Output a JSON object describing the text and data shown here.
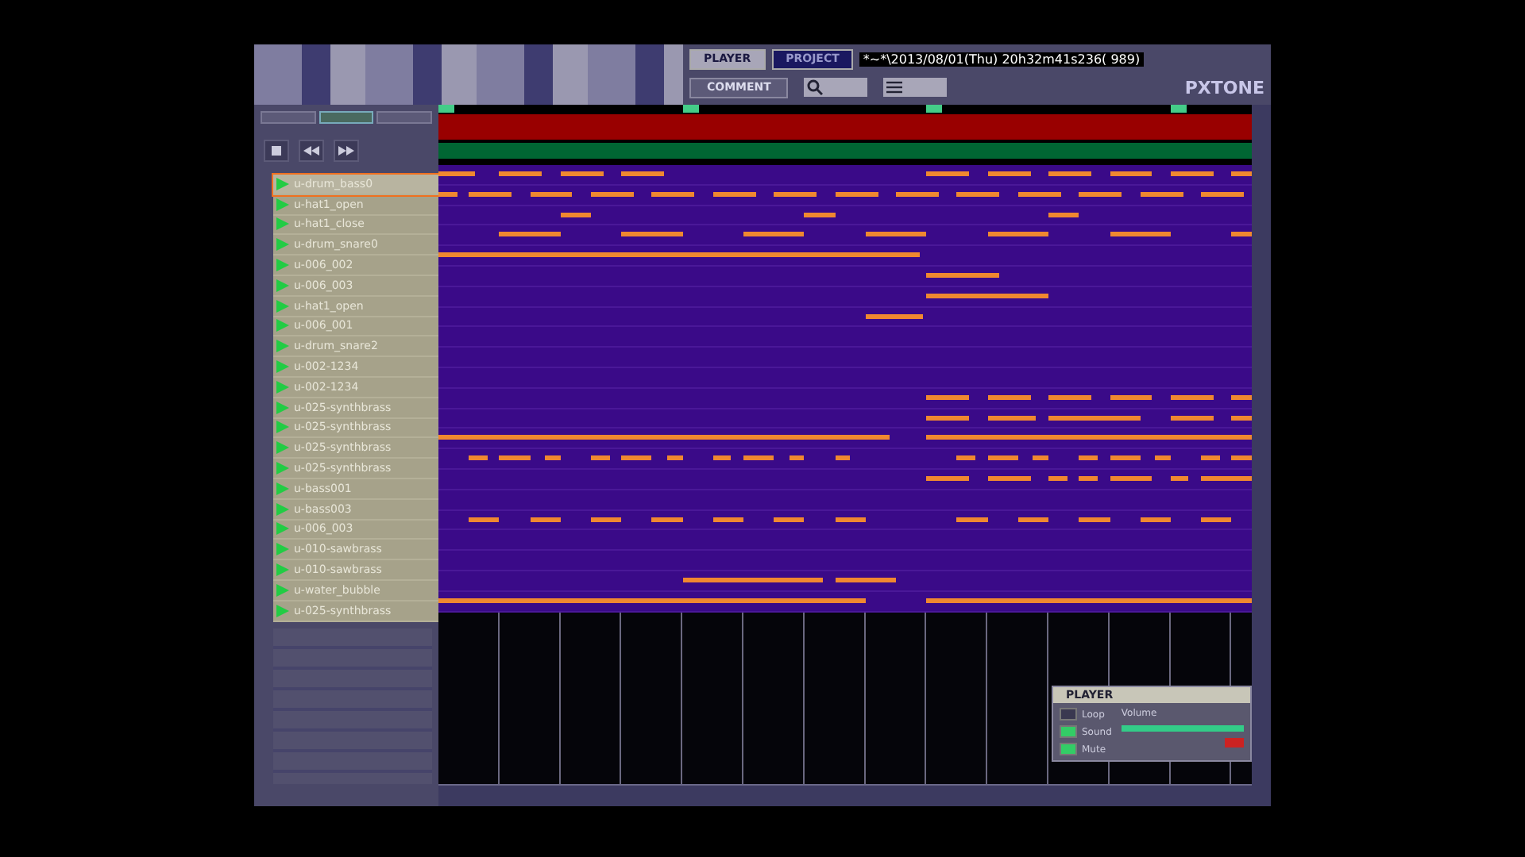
{
  "header": {
    "tabs": [
      {
        "label": "PLAYER",
        "selected": false
      },
      {
        "label": "PROJECT",
        "selected": true
      }
    ],
    "title": "*~*\\2013/08/01(Thu) 20h32m41s236( 989)",
    "comment_button": "COMMENT",
    "logo": "PXTONE"
  },
  "left_tabs": [
    {
      "selected": false
    },
    {
      "selected": true
    },
    {
      "selected": false
    }
  ],
  "units": [
    {
      "name": "u-drum_bass0",
      "selected": true
    },
    {
      "name": "u-hat1_open",
      "selected": false
    },
    {
      "name": "u-hat1_close",
      "selected": false
    },
    {
      "name": "u-drum_snare0",
      "selected": false
    },
    {
      "name": "u-006_002",
      "selected": false
    },
    {
      "name": "u-006_003",
      "selected": false
    },
    {
      "name": "u-hat1_open",
      "selected": false
    },
    {
      "name": "u-006_001",
      "selected": false
    },
    {
      "name": "u-drum_snare2",
      "selected": false
    },
    {
      "name": "u-002-1234",
      "selected": false
    },
    {
      "name": "u-002-1234",
      "selected": false
    },
    {
      "name": "u-025-synthbrass",
      "selected": false
    },
    {
      "name": "u-025-synthbrass",
      "selected": false
    },
    {
      "name": "u-025-synthbrass",
      "selected": false
    },
    {
      "name": "u-025-synthbrass",
      "selected": false
    },
    {
      "name": "u-bass001",
      "selected": false
    },
    {
      "name": "u-bass003",
      "selected": false
    },
    {
      "name": "u-006_003",
      "selected": false
    },
    {
      "name": "u-010-sawbrass",
      "selected": false
    },
    {
      "name": "u-010-sawbrass",
      "selected": false
    },
    {
      "name": "u-water_bubble",
      "selected": false
    },
    {
      "name": "u-025-synthbrass",
      "selected": false
    }
  ],
  "player": {
    "title": "PLAYER",
    "loop": {
      "label": "Loop",
      "checked": false
    },
    "sound": {
      "label": "Sound",
      "checked": true
    },
    "mute": {
      "label": "Mute",
      "checked": true
    },
    "volume": {
      "label": "Volume",
      "level": 1.0
    }
  }
}
